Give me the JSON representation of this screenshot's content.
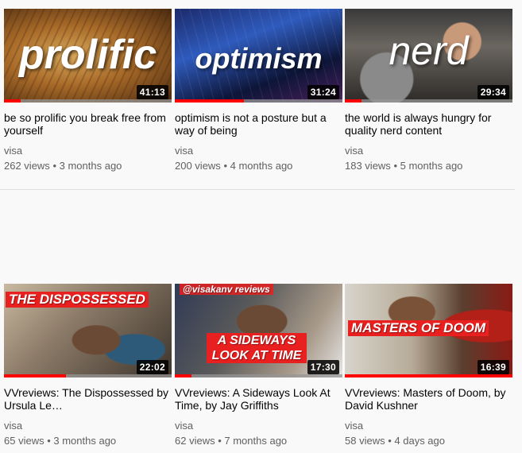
{
  "videos": [
    {
      "overlay": "prolific",
      "duration": "41:13",
      "title": "be so prolific you break free from yourself",
      "channel": "visa",
      "views": "262 views",
      "age": "3 months ago",
      "progress": 0.1
    },
    {
      "overlay": "optimism",
      "duration": "31:24",
      "title": "optimism is not a posture but a way of being",
      "channel": "visa",
      "views": "200 views",
      "age": "4 months ago",
      "progress": 0.41
    },
    {
      "overlay": "nerd",
      "duration": "29:34",
      "title": "the world is always hungry for quality nerd content",
      "channel": "visa",
      "views": "183 views",
      "age": "5 months ago",
      "progress": 0.1
    },
    {
      "overlay": "THE DISPOSSESSED",
      "duration": "22:02",
      "title": "VVreviews: The Dispossessed by Ursula Le…",
      "channel": "visa",
      "views": "65 views",
      "age": "3 months ago",
      "progress": 0.37
    },
    {
      "overlay": "A SIDEWAYS LOOK AT TIME",
      "overlay_top": "@visakanv reviews",
      "duration": "17:30",
      "title": "VVreviews: A Sideways Look At Time, by Jay Griffiths",
      "channel": "visa",
      "views": "62 views",
      "age": "7 months ago",
      "progress": 0.1
    },
    {
      "overlay": "MASTERS OF DOOM",
      "duration": "16:39",
      "title": "VVreviews: Masters of Doom, by David Kushner",
      "channel": "visa",
      "views": "58 views",
      "age": "4 days ago",
      "progress": 1.0
    }
  ],
  "separator": "•",
  "colors": {
    "progress": "#ff0000",
    "banner": "#e8201f",
    "meta": "#606060"
  }
}
